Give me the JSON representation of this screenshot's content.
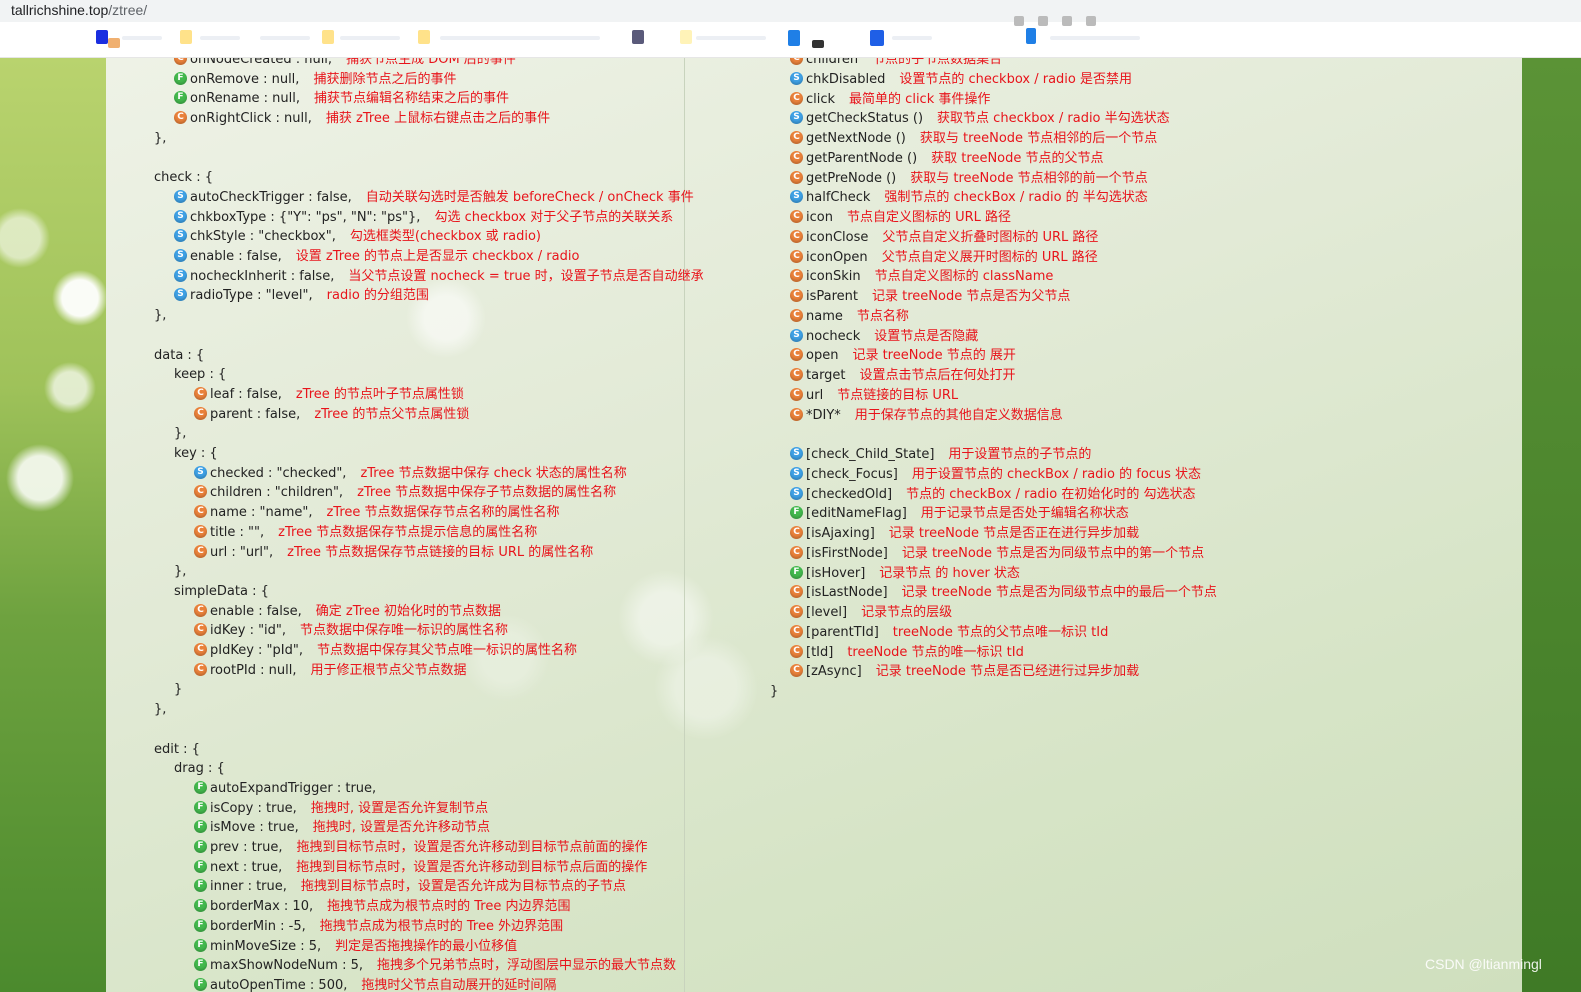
{
  "browser": {
    "url_host": "tallrichshine.top",
    "url_path": "/ztree/"
  },
  "colors": {
    "code": "#222222",
    "desc": "#e8141b",
    "icon_f": "#43b84d",
    "icon_c": "#e9813a",
    "icon_s": "#3ea0e4"
  },
  "left_lines": [
    {
      "indent": 1,
      "icon": "C",
      "code": "onNodeCreated : null,",
      "desc": "捕获节点生成 DOM 后的事件"
    },
    {
      "indent": 1,
      "icon": "F",
      "code": "onRemove : null,",
      "desc": "捕获删除节点之后的事件"
    },
    {
      "indent": 1,
      "icon": "F",
      "code": "onRename : null,",
      "desc": "捕获节点编辑名称结束之后的事件"
    },
    {
      "indent": 1,
      "icon": "C",
      "code": "onRightClick : null,",
      "desc": "捕获 zTree 上鼠标右键点击之后的事件"
    },
    {
      "indent": 0,
      "icon": "",
      "code": "},",
      "desc": ""
    },
    {
      "indent": 0,
      "icon": "",
      "code": "",
      "desc": ""
    },
    {
      "indent": 0,
      "icon": "",
      "code": "check : {",
      "desc": ""
    },
    {
      "indent": 1,
      "icon": "S",
      "code": "autoCheckTrigger : false,",
      "desc": "自动关联勾选时是否触发 beforeCheck / onCheck 事件"
    },
    {
      "indent": 1,
      "icon": "S",
      "code": "chkboxType : {\"Y\": \"ps\", \"N\": \"ps\"},",
      "desc": "勾选 checkbox 对于父子节点的关联关系"
    },
    {
      "indent": 1,
      "icon": "S",
      "code": "chkStyle : \"checkbox\",",
      "desc": "勾选框类型(checkbox 或 radio)"
    },
    {
      "indent": 1,
      "icon": "S",
      "code": "enable : false,",
      "desc": "设置 zTree 的节点上是否显示 checkbox / radio"
    },
    {
      "indent": 1,
      "icon": "S",
      "code": "nocheckInherit : false,",
      "desc": "当父节点设置 nocheck = true 时，设置子节点是否自动继承"
    },
    {
      "indent": 1,
      "icon": "S",
      "code": "radioType : \"level\",",
      "desc": "radio 的分组范围"
    },
    {
      "indent": 0,
      "icon": "",
      "code": "},",
      "desc": ""
    },
    {
      "indent": 0,
      "icon": "",
      "code": "",
      "desc": ""
    },
    {
      "indent": 0,
      "icon": "",
      "code": "data : {",
      "desc": ""
    },
    {
      "indent": 1,
      "icon": "",
      "code": "keep : {",
      "desc": ""
    },
    {
      "indent": 2,
      "icon": "C",
      "code": "leaf : false,",
      "desc": "zTree 的节点叶子节点属性锁"
    },
    {
      "indent": 2,
      "icon": "C",
      "code": "parent : false,",
      "desc": "zTree 的节点父节点属性锁"
    },
    {
      "indent": 1,
      "icon": "",
      "code": "},",
      "desc": ""
    },
    {
      "indent": 1,
      "icon": "",
      "code": "key : {",
      "desc": ""
    },
    {
      "indent": 2,
      "icon": "S",
      "code": "checked : \"checked\",",
      "desc": "zTree 节点数据中保存 check 状态的属性名称"
    },
    {
      "indent": 2,
      "icon": "C",
      "code": "children : \"children\",",
      "desc": "zTree 节点数据中保存子节点数据的属性名称"
    },
    {
      "indent": 2,
      "icon": "C",
      "code": "name : \"name\",",
      "desc": "zTree 节点数据保存节点名称的属性名称"
    },
    {
      "indent": 2,
      "icon": "C",
      "code": "title : \"\",",
      "desc": "zTree 节点数据保存节点提示信息的属性名称"
    },
    {
      "indent": 2,
      "icon": "C",
      "code": "url : \"url\",",
      "desc": "zTree 节点数据保存节点链接的目标 URL 的属性名称"
    },
    {
      "indent": 1,
      "icon": "",
      "code": "},",
      "desc": ""
    },
    {
      "indent": 1,
      "icon": "",
      "code": "simpleData : {",
      "desc": ""
    },
    {
      "indent": 2,
      "icon": "C",
      "code": "enable : false,",
      "desc": "确定 zTree 初始化时的节点数据"
    },
    {
      "indent": 2,
      "icon": "C",
      "code": "idKey : \"id\",",
      "desc": "节点数据中保存唯一标识的属性名称"
    },
    {
      "indent": 2,
      "icon": "C",
      "code": "pIdKey : \"pId\",",
      "desc": "节点数据中保存其父节点唯一标识的属性名称"
    },
    {
      "indent": 2,
      "icon": "C",
      "code": "rootPId : null,",
      "desc": "用于修正根节点父节点数据"
    },
    {
      "indent": 1,
      "icon": "",
      "code": "}",
      "desc": ""
    },
    {
      "indent": 0,
      "icon": "",
      "code": "},",
      "desc": ""
    },
    {
      "indent": 0,
      "icon": "",
      "code": "",
      "desc": ""
    },
    {
      "indent": 0,
      "icon": "",
      "code": "edit : {",
      "desc": ""
    },
    {
      "indent": 1,
      "icon": "",
      "code": "drag : {",
      "desc": ""
    },
    {
      "indent": 2,
      "icon": "F",
      "code": "autoExpandTrigger : true,",
      "desc": ""
    },
    {
      "indent": 2,
      "icon": "F",
      "code": "isCopy : true,",
      "desc": "拖拽时, 设置是否允许复制节点"
    },
    {
      "indent": 2,
      "icon": "F",
      "code": "isMove : true,",
      "desc": "拖拽时, 设置是否允许移动节点"
    },
    {
      "indent": 2,
      "icon": "F",
      "code": "prev : true,",
      "desc": "拖拽到目标节点时，设置是否允许移动到目标节点前面的操作"
    },
    {
      "indent": 2,
      "icon": "F",
      "code": "next : true,",
      "desc": "拖拽到目标节点时，设置是否允许移动到目标节点后面的操作"
    },
    {
      "indent": 2,
      "icon": "F",
      "code": "inner : true,",
      "desc": "拖拽到目标节点时，设置是否允许成为目标节点的子节点"
    },
    {
      "indent": 2,
      "icon": "F",
      "code": "borderMax : 10,",
      "desc": "拖拽节点成为根节点时的 Tree 内边界范围"
    },
    {
      "indent": 2,
      "icon": "F",
      "code": "borderMin : -5,",
      "desc": "拖拽节点成为根节点时的 Tree 外边界范围"
    },
    {
      "indent": 2,
      "icon": "F",
      "code": "minMoveSize : 5,",
      "desc": "判定是否拖拽操作的最小位移值"
    },
    {
      "indent": 2,
      "icon": "F",
      "code": "maxShowNodeNum : 5,",
      "desc": "拖拽多个兄弟节点时，浮动图层中显示的最大节点数"
    },
    {
      "indent": 2,
      "icon": "F",
      "code": "autoOpenTime : 500,",
      "desc": "拖拽时父节点自动展开的延时间隔"
    }
  ],
  "right_lines": [
    {
      "indent": 1,
      "icon": "C",
      "code": "children",
      "desc": "节点的子节点数据集合"
    },
    {
      "indent": 1,
      "icon": "S",
      "code": "chkDisabled",
      "desc": "设置节点的 checkbox / radio 是否禁用"
    },
    {
      "indent": 1,
      "icon": "C",
      "code": "click",
      "desc": "最简单的 click 事件操作"
    },
    {
      "indent": 1,
      "icon": "S",
      "code": "getCheckStatus ()",
      "desc": "获取节点 checkbox / radio 半勾选状态"
    },
    {
      "indent": 1,
      "icon": "C",
      "code": "getNextNode ()",
      "desc": "获取与 treeNode 节点相邻的后一个节点"
    },
    {
      "indent": 1,
      "icon": "C",
      "code": "getParentNode ()",
      "desc": "获取 treeNode 节点的父节点"
    },
    {
      "indent": 1,
      "icon": "C",
      "code": "getPreNode ()",
      "desc": "获取与 treeNode 节点相邻的前一个节点"
    },
    {
      "indent": 1,
      "icon": "S",
      "code": "halfCheck",
      "desc": "强制节点的 checkBox / radio 的 半勾选状态"
    },
    {
      "indent": 1,
      "icon": "C",
      "code": "icon",
      "desc": "节点自定义图标的 URL 路径"
    },
    {
      "indent": 1,
      "icon": "C",
      "code": "iconClose",
      "desc": "父节点自定义折叠时图标的 URL 路径"
    },
    {
      "indent": 1,
      "icon": "C",
      "code": "iconOpen",
      "desc": "父节点自定义展开时图标的 URL 路径"
    },
    {
      "indent": 1,
      "icon": "C",
      "code": "iconSkin",
      "desc": "节点自定义图标的 className"
    },
    {
      "indent": 1,
      "icon": "C",
      "code": "isParent",
      "desc": "记录 treeNode 节点是否为父节点"
    },
    {
      "indent": 1,
      "icon": "C",
      "code": "name",
      "desc": "节点名称"
    },
    {
      "indent": 1,
      "icon": "S",
      "code": "nocheck",
      "desc": "设置节点是否隐藏"
    },
    {
      "indent": 1,
      "icon": "C",
      "code": "open",
      "desc": "记录 treeNode 节点的 展开"
    },
    {
      "indent": 1,
      "icon": "C",
      "code": "target",
      "desc": "设置点击节点后在何处打开"
    },
    {
      "indent": 1,
      "icon": "C",
      "code": "url",
      "desc": "节点链接的目标 URL"
    },
    {
      "indent": 1,
      "icon": "C",
      "code": "*DIY*",
      "desc": "用于保存节点的其他自定义数据信息"
    },
    {
      "indent": 1,
      "icon": "",
      "code": "",
      "desc": ""
    },
    {
      "indent": 1,
      "icon": "S",
      "code": "[check_Child_State]",
      "desc": "用于设置节点的子节点的"
    },
    {
      "indent": 1,
      "icon": "S",
      "code": "[check_Focus]",
      "desc": "用于设置节点的 checkBox / radio 的 focus 状态"
    },
    {
      "indent": 1,
      "icon": "S",
      "code": "[checkedOld]",
      "desc": "节点的 checkBox / radio 在初始化时的 勾选状态"
    },
    {
      "indent": 1,
      "icon": "F",
      "code": "[editNameFlag]",
      "desc": "用于记录节点是否处于编辑名称状态"
    },
    {
      "indent": 1,
      "icon": "C",
      "code": "[isAjaxing]",
      "desc": "记录 treeNode 节点是否正在进行异步加载"
    },
    {
      "indent": 1,
      "icon": "C",
      "code": "[isFirstNode]",
      "desc": "记录 treeNode 节点是否为同级节点中的第一个节点"
    },
    {
      "indent": 1,
      "icon": "F",
      "code": "[isHover]",
      "desc": "记录节点 的 hover 状态"
    },
    {
      "indent": 1,
      "icon": "C",
      "code": "[isLastNode]",
      "desc": "记录 treeNode 节点是否为同级节点中的最后一个节点"
    },
    {
      "indent": 1,
      "icon": "C",
      "code": "[level]",
      "desc": "记录节点的层级"
    },
    {
      "indent": 1,
      "icon": "C",
      "code": "[parentTId]",
      "desc": "treeNode 节点的父节点唯一标识 tId"
    },
    {
      "indent": 1,
      "icon": "C",
      "code": "[tId]",
      "desc": "treeNode 节点的唯一标识 tId"
    },
    {
      "indent": 1,
      "icon": "C",
      "code": "[zAsync]",
      "desc": "记录 treeNode 节点是否已经进行过异步加载"
    },
    {
      "indent": 0,
      "icon": "",
      "code": "}",
      "desc": ""
    }
  ],
  "watermark": "CSDN @ltianmingl"
}
